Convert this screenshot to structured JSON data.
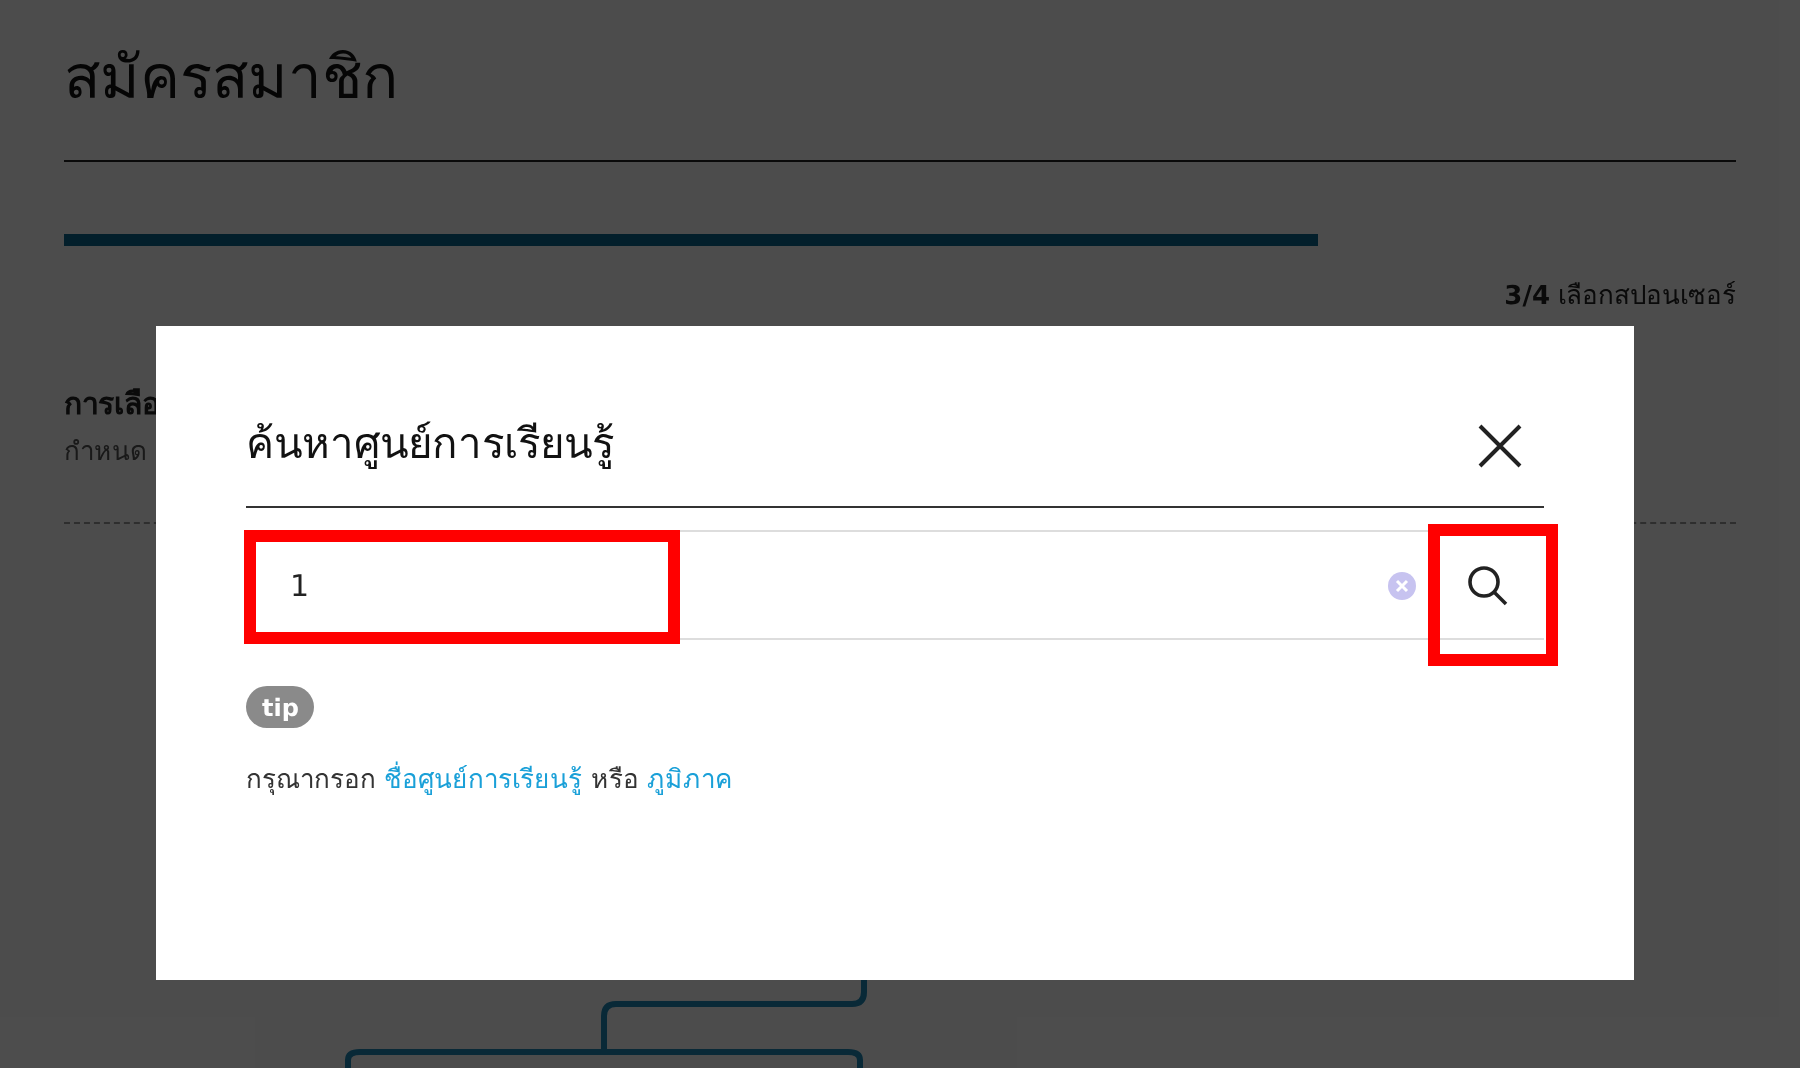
{
  "page": {
    "title": "สมัครสมาชิก",
    "progress": {
      "level": 0.75
    },
    "step": "3/4",
    "step_label": "เลือกสปอนเซอร์",
    "section_title": "การเลือ",
    "section_subtitle": "กำหนด"
  },
  "modal": {
    "title": "ค้นหาศูนย์การเรียนรู้",
    "search": {
      "value": "1",
      "highlighted": true
    },
    "search_button": {
      "highlighted": true
    },
    "tip_badge": "tip",
    "hint": [
      {
        "kind": "text",
        "text": "กรุณากรอก "
      },
      {
        "kind": "link",
        "text": "ชื่อศูนย์การเรียนรู้"
      },
      {
        "kind": "text",
        "text": " หรือ "
      },
      {
        "kind": "link",
        "text": "ภูมิภาค"
      }
    ]
  }
}
